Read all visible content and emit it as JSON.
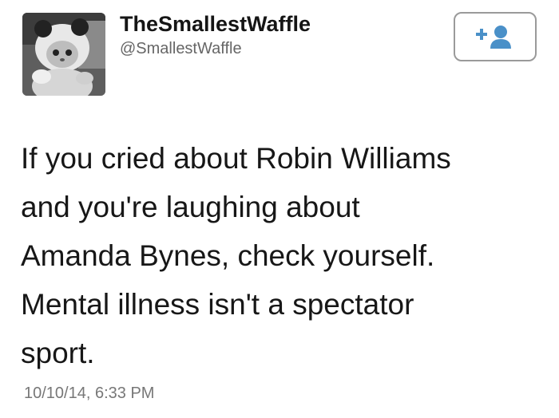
{
  "user": {
    "display_name": "TheSmallestWaffle",
    "handle": "@SmallestWaffle",
    "avatar_icon": "avatar-kitten-photo"
  },
  "follow_button": {
    "icon": "add-user-icon"
  },
  "tweet": {
    "lines": [
      "If you cried about Robin Williams",
      "and you're laughing about",
      "Amanda Bynes, check yourself.",
      "Mental illness isn't a spectator",
      "sport."
    ],
    "timestamp": "10/10/14, 6:33 PM"
  }
}
